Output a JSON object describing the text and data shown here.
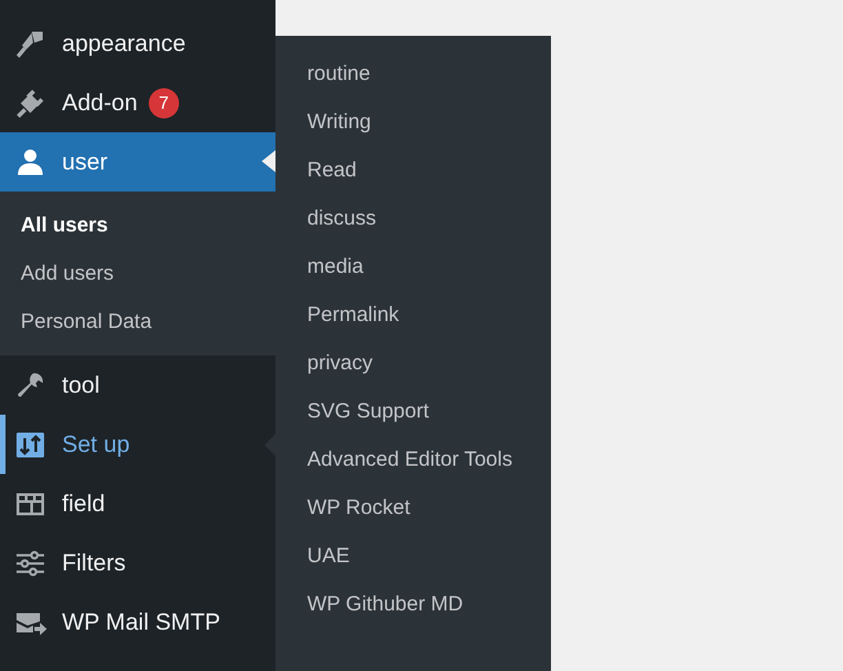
{
  "sidebar": {
    "menu": [
      {
        "label": "appearance",
        "selected": false,
        "open": false
      },
      {
        "label": "Add-on",
        "badge": "7",
        "selected": false,
        "open": false
      },
      {
        "label": "user",
        "selected": true,
        "open": false,
        "children": [
          {
            "label": "All users",
            "selected": true
          },
          {
            "label": "Add users",
            "selected": false
          },
          {
            "label": "Personal Data",
            "selected": false
          }
        ]
      },
      {
        "label": "tool",
        "selected": false,
        "open": false
      },
      {
        "label": "Set up",
        "selected": false,
        "open": true,
        "flyout": [
          {
            "label": "routine"
          },
          {
            "label": "Writing"
          },
          {
            "label": "Read"
          },
          {
            "label": "discuss"
          },
          {
            "label": "media"
          },
          {
            "label": "Permalink"
          },
          {
            "label": "privacy"
          },
          {
            "label": "SVG Support"
          },
          {
            "label": "Advanced Editor Tools"
          },
          {
            "label": "WP Rocket"
          },
          {
            "label": "UAE"
          },
          {
            "label": "WP Githuber MD"
          }
        ]
      },
      {
        "label": "field",
        "selected": false,
        "open": false
      },
      {
        "label": "Filters",
        "selected": false,
        "open": false
      },
      {
        "label": "WP Mail SMTP",
        "selected": false,
        "open": false
      }
    ]
  }
}
